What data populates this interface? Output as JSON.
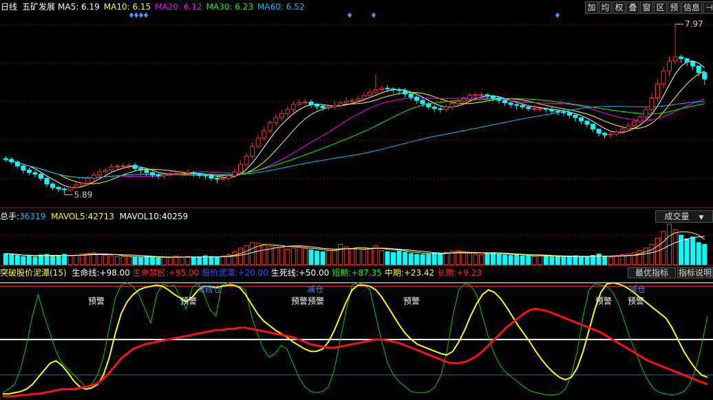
{
  "header": {
    "period": "日线",
    "stock_name": "五矿发展",
    "ma": [
      {
        "label": "MA5:",
        "value": "6.19",
        "color": "#ffffff"
      },
      {
        "label": "MA10:",
        "value": "6.15",
        "color": "#ffff00"
      },
      {
        "label": "MA20:",
        "value": "6.12",
        "color": "#ff00ff"
      },
      {
        "label": "MA30:",
        "value": "6.23",
        "color": "#00ff00"
      },
      {
        "label": "MA60:",
        "value": "6.52",
        "color": "#00bfff"
      }
    ],
    "toolbar": [
      "加",
      "均",
      "权",
      "叠",
      "窗",
      "区",
      "预",
      "信息",
      "⊣"
    ]
  },
  "price_panel": {
    "high_label": "7.97",
    "low_label": "5.89",
    "y_range": [
      5.75,
      8.08
    ]
  },
  "volume_panel": {
    "label": "总手:",
    "value": "36319",
    "mavol5_label": "MAVOL5:",
    "mavol5_value": "42713",
    "mavol10_label": "MAVOL10:",
    "mavol10_value": "40259",
    "selector": "成交量"
  },
  "indicator_panel": {
    "name": "突破股价泥潭(15)",
    "items": [
      {
        "label": "生命线:",
        "value": "+98.00",
        "color": "#ffffff"
      },
      {
        "label": "生命禁区:",
        "value": "+95.00",
        "color": "#ff2020"
      },
      {
        "label": "股价泥潭:",
        "value": "+20.00",
        "color": "#3a50ff"
      },
      {
        "label": "生死线:",
        "value": "+50.00",
        "color": "#ffffff"
      },
      {
        "label": "短期:",
        "value": "+87.35",
        "color": "#00ff00"
      },
      {
        "label": "中期:",
        "value": "+23.42",
        "color": "#ffff00"
      },
      {
        "label": "长期:",
        "value": "+9.23",
        "color": "#ff2020"
      }
    ],
    "btn_best": "最优指标",
    "btn_help": "指标说明",
    "signals": [
      "预警",
      "预警",
      "减磅仓",
      "预警预警",
      "减仓",
      "预警",
      "预警",
      "预警",
      "减仓"
    ],
    "levels": [
      98,
      95,
      50,
      20
    ]
  },
  "chart_data": {
    "type": "candlestick",
    "candle_count": 120,
    "open": [
      6.33,
      6.32,
      6.29,
      6.24,
      6.19,
      6.16,
      6.14,
      6.09,
      6.02,
      5.98,
      5.96,
      5.95,
      5.98,
      6.01,
      6.03,
      6.09,
      6.13,
      6.17,
      6.19,
      6.23,
      6.24,
      6.24,
      6.25,
      6.21,
      6.19,
      6.16,
      6.13,
      6.12,
      6.14,
      6.15,
      6.15,
      6.15,
      6.16,
      6.15,
      6.13,
      6.12,
      6.09,
      6.08,
      6.09,
      6.12,
      6.17,
      6.26,
      6.36,
      6.48,
      6.58,
      6.67,
      6.77,
      6.83,
      6.88,
      6.93,
      6.99,
      7.01,
      7.02,
      6.99,
      6.97,
      6.95,
      6.96,
      6.98,
      7.01,
      7.03,
      7.04,
      7.06,
      7.1,
      7.14,
      7.17,
      7.19,
      7.18,
      7.17,
      7.16,
      7.12,
      7.08,
      7.04,
      7.0,
      6.96,
      6.94,
      6.93,
      6.96,
      7.0,
      7.03,
      7.06,
      7.1,
      7.11,
      7.11,
      7.09,
      7.07,
      7.04,
      7.01,
      6.99,
      6.98,
      6.96,
      6.94,
      6.94,
      6.94,
      6.93,
      6.91,
      6.9,
      6.89,
      6.86,
      6.83,
      6.79,
      6.75,
      6.69,
      6.64,
      6.62,
      6.63,
      6.66,
      6.69,
      6.73,
      6.78,
      6.84,
      6.93,
      7.07,
      7.24,
      7.4,
      7.52,
      7.57,
      7.55,
      7.51,
      7.46,
      7.38
    ],
    "close": [
      6.32,
      6.29,
      6.24,
      6.19,
      6.16,
      6.14,
      6.09,
      6.02,
      5.98,
      5.96,
      5.95,
      5.98,
      6.01,
      6.03,
      6.09,
      6.13,
      6.17,
      6.19,
      6.23,
      6.24,
      6.24,
      6.25,
      6.21,
      6.19,
      6.16,
      6.13,
      6.12,
      6.14,
      6.15,
      6.15,
      6.15,
      6.16,
      6.15,
      6.13,
      6.12,
      6.09,
      6.08,
      6.09,
      6.12,
      6.17,
      6.26,
      6.36,
      6.48,
      6.58,
      6.67,
      6.77,
      6.83,
      6.88,
      6.93,
      6.99,
      7.01,
      7.02,
      6.99,
      6.97,
      6.95,
      6.96,
      6.98,
      7.01,
      7.03,
      7.04,
      7.06,
      7.1,
      7.14,
      7.17,
      7.19,
      7.18,
      7.17,
      7.16,
      7.12,
      7.08,
      7.04,
      7.0,
      6.96,
      6.94,
      6.93,
      6.96,
      7.0,
      7.03,
      7.06,
      7.1,
      7.11,
      7.11,
      7.09,
      7.07,
      7.04,
      7.01,
      6.99,
      6.98,
      6.96,
      6.94,
      6.94,
      6.94,
      6.93,
      6.91,
      6.9,
      6.89,
      6.86,
      6.83,
      6.79,
      6.75,
      6.69,
      6.64,
      6.62,
      6.63,
      6.66,
      6.69,
      6.73,
      6.78,
      6.84,
      6.93,
      7.07,
      7.24,
      7.4,
      7.52,
      7.57,
      7.55,
      7.51,
      7.46,
      7.38,
      7.3
    ],
    "high": [
      6.36,
      6.35,
      6.31,
      6.27,
      6.22,
      6.19,
      6.16,
      6.11,
      6.04,
      6.0,
      5.98,
      6.0,
      6.04,
      6.05,
      6.12,
      6.16,
      6.21,
      6.22,
      6.27,
      6.26,
      6.28,
      6.28,
      6.28,
      6.23,
      6.21,
      6.18,
      6.15,
      6.18,
      6.17,
      6.19,
      6.17,
      6.2,
      6.18,
      6.16,
      6.15,
      6.14,
      6.11,
      6.12,
      6.16,
      6.21,
      6.31,
      6.4,
      6.53,
      6.62,
      6.72,
      6.8,
      6.88,
      6.92,
      6.97,
      7.03,
      7.05,
      7.06,
      7.05,
      7.01,
      6.99,
      6.99,
      7.03,
      7.04,
      7.08,
      7.07,
      7.1,
      7.14,
      7.18,
      7.36,
      7.22,
      7.23,
      7.2,
      7.2,
      7.19,
      7.14,
      7.1,
      7.07,
      7.02,
      6.99,
      6.96,
      6.99,
      7.04,
      7.06,
      7.09,
      7.13,
      7.15,
      7.14,
      7.13,
      7.11,
      7.09,
      7.06,
      7.03,
      7.01,
      7.01,
      6.98,
      6.98,
      6.97,
      6.96,
      6.96,
      6.93,
      6.93,
      6.91,
      6.87,
      6.83,
      6.79,
      6.74,
      6.68,
      6.66,
      6.67,
      6.69,
      6.74,
      6.77,
      6.82,
      6.89,
      6.97,
      7.13,
      7.3,
      7.45,
      7.58,
      7.97,
      7.6,
      7.55,
      7.52,
      7.45,
      7.4
    ],
    "low": [
      6.29,
      6.26,
      6.21,
      6.15,
      6.13,
      6.1,
      6.06,
      5.98,
      5.95,
      5.92,
      5.89,
      5.93,
      5.97,
      5.99,
      6.01,
      6.06,
      6.1,
      6.15,
      6.17,
      6.2,
      6.21,
      6.2,
      6.18,
      6.15,
      6.12,
      6.1,
      6.08,
      6.09,
      6.11,
      6.12,
      6.11,
      6.13,
      6.11,
      6.09,
      6.08,
      6.06,
      6.03,
      6.05,
      6.06,
      6.11,
      6.15,
      6.23,
      6.33,
      6.45,
      6.54,
      6.64,
      6.73,
      6.79,
      6.84,
      6.89,
      6.97,
      6.98,
      6.95,
      6.93,
      6.91,
      6.92,
      6.93,
      6.95,
      6.99,
      7.0,
      7.01,
      7.03,
      7.07,
      7.11,
      7.15,
      7.14,
      7.13,
      7.11,
      7.08,
      7.04,
      7.0,
      6.96,
      6.93,
      6.9,
      6.89,
      6.9,
      6.92,
      6.97,
      7.0,
      7.03,
      7.06,
      7.06,
      7.05,
      7.03,
      7.0,
      6.97,
      6.95,
      6.93,
      6.93,
      6.91,
      6.9,
      6.9,
      6.89,
      6.87,
      6.86,
      6.85,
      6.82,
      6.78,
      6.75,
      6.71,
      6.65,
      6.6,
      6.58,
      6.58,
      6.6,
      6.63,
      6.66,
      6.7,
      6.75,
      6.8,
      6.88,
      7.02,
      7.19,
      7.34,
      7.48,
      7.5,
      7.46,
      7.41,
      7.33,
      7.23
    ],
    "volume": [
      30,
      27,
      25,
      22,
      24,
      21,
      26,
      28,
      23,
      25,
      28,
      24,
      26,
      29,
      31,
      33,
      28,
      26,
      24,
      22,
      21,
      23,
      20,
      19,
      22,
      21,
      18,
      20,
      19,
      23,
      21,
      22,
      20,
      19,
      24,
      22,
      20,
      23,
      27,
      35,
      45,
      52,
      60,
      58,
      55,
      49,
      52,
      47,
      42,
      45,
      50,
      44,
      40,
      37,
      35,
      38,
      41,
      55,
      48,
      43,
      46,
      40,
      44,
      52,
      38,
      35,
      33,
      37,
      34,
      30,
      28,
      27,
      29,
      32,
      30,
      33,
      36,
      38,
      34,
      31,
      29,
      27,
      30,
      32,
      28,
      26,
      25,
      27,
      24,
      23,
      22,
      26,
      24,
      21,
      23,
      20,
      22,
      24,
      21,
      20,
      25,
      29,
      22,
      20,
      24,
      27,
      30,
      33,
      38,
      45,
      55,
      72,
      90,
      110,
      95,
      80,
      70,
      75,
      60,
      55
    ],
    "mavol5": [
      30,
      29,
      28,
      26,
      25,
      24,
      24,
      24,
      24,
      24,
      26,
      25,
      25,
      26,
      28,
      29,
      29,
      29,
      28,
      27,
      24,
      23,
      22,
      21,
      21,
      21,
      20,
      20,
      20,
      20,
      20,
      21,
      21,
      21,
      21,
      21,
      21,
      22,
      23,
      26,
      30,
      36,
      44,
      50,
      54,
      54,
      53,
      52,
      49,
      49,
      47,
      46,
      44,
      43,
      41,
      39,
      38,
      41,
      43,
      44,
      46,
      46,
      44,
      45,
      44,
      42,
      40,
      40,
      38,
      34,
      33,
      31,
      30,
      29,
      29,
      30,
      32,
      34,
      34,
      33,
      33,
      32,
      30,
      29,
      29,
      29,
      28,
      28,
      27,
      25,
      24,
      24,
      24,
      23,
      23,
      22,
      22,
      22,
      22,
      21,
      22,
      24,
      23,
      23,
      24,
      24,
      25,
      26,
      30,
      35,
      40,
      50,
      62,
      78,
      86,
      89,
      89,
      86,
      80,
      68
    ],
    "series": [
      {
        "name": "MA5",
        "color": "#ffffff"
      },
      {
        "name": "MA10",
        "color": "#ffff00"
      },
      {
        "name": "MA20",
        "color": "#ff00ff"
      },
      {
        "name": "MA30",
        "color": "#00ff00"
      },
      {
        "name": "MA60",
        "color": "#00bfff"
      }
    ],
    "indicator": {
      "短期": [
        5,
        8,
        12,
        25,
        45,
        70,
        88,
        70,
        55,
        40,
        30,
        25,
        20,
        15,
        10,
        12,
        20,
        35,
        60,
        85,
        96,
        98,
        95,
        88,
        76,
        64,
        88,
        97,
        95,
        96,
        85,
        76,
        94,
        98,
        88,
        75,
        70,
        96,
        98,
        96,
        95,
        92,
        70,
        55,
        42,
        35,
        38,
        45,
        42,
        30,
        18,
        10,
        6,
        5,
        6,
        10,
        25,
        50,
        75,
        96,
        98,
        96,
        92,
        70,
        48,
        30,
        20,
        14,
        10,
        6,
        5,
        5,
        6,
        10,
        20,
        40,
        70,
        92,
        97,
        96,
        88,
        70,
        52,
        38,
        28,
        22,
        18,
        14,
        10,
        7,
        5,
        4,
        3,
        3,
        4,
        8,
        20,
        40,
        70,
        92,
        97,
        96,
        95,
        90,
        80,
        65,
        50,
        38,
        25,
        15,
        8,
        5,
        4,
        3,
        4,
        6,
        12,
        25,
        45,
        70
      ],
      "中期": [
        4,
        4,
        5,
        6,
        8,
        12,
        18,
        24,
        30,
        32,
        28,
        22,
        15,
        10,
        8,
        9,
        12,
        20,
        35,
        55,
        72,
        82,
        88,
        92,
        94,
        95,
        96,
        95,
        92,
        88,
        85,
        82,
        86,
        92,
        95,
        95,
        94,
        95,
        96,
        96,
        94,
        88,
        80,
        72,
        66,
        62,
        58,
        55,
        52,
        48,
        45,
        42,
        40,
        40,
        42,
        48,
        58,
        70,
        82,
        92,
        96,
        96,
        95,
        92,
        86,
        78,
        70,
        62,
        55,
        50,
        46,
        44,
        42,
        40,
        38,
        37,
        40,
        48,
        58,
        70,
        80,
        88,
        92,
        90,
        85,
        78,
        70,
        62,
        55,
        48,
        40,
        33,
        27,
        22,
        18,
        16,
        18,
        26,
        40,
        58,
        76,
        90,
        97,
        98,
        97,
        95,
        92,
        88,
        84,
        80,
        76,
        72,
        68,
        60,
        50,
        40,
        32,
        25,
        20,
        18
      ],
      "长期": [
        2,
        2,
        2,
        3,
        3,
        4,
        4,
        5,
        6,
        7,
        8,
        8,
        8,
        9,
        10,
        11,
        13,
        17,
        22,
        28,
        34,
        38,
        42,
        44,
        46,
        47,
        48,
        49,
        50,
        51,
        52,
        53,
        54,
        55,
        56,
        57,
        58,
        58,
        59,
        59,
        60,
        60,
        59,
        58,
        57,
        56,
        55,
        54,
        53,
        52,
        50,
        48,
        46,
        45,
        44,
        43,
        43,
        44,
        45,
        46,
        47,
        48,
        49,
        50,
        50,
        49,
        48,
        47,
        45,
        43,
        41,
        39,
        37,
        35,
        33,
        31,
        30,
        30,
        31,
        33,
        36,
        40,
        45,
        50,
        55,
        60,
        64,
        68,
        72,
        75,
        76,
        75,
        74,
        72,
        70,
        68,
        66,
        64,
        62,
        60,
        58,
        56,
        53,
        50,
        47,
        44,
        41,
        38,
        35,
        32,
        30,
        28,
        26,
        24,
        22,
        20,
        18,
        16,
        14,
        12
      ]
    }
  }
}
